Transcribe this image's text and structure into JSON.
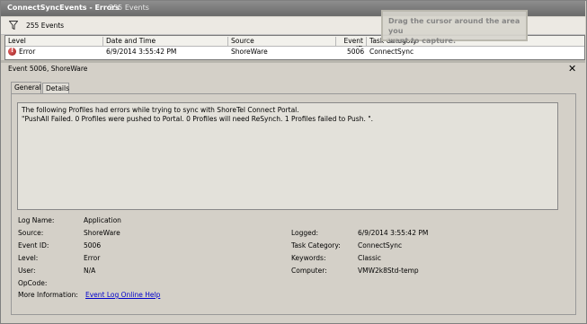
{
  "window": {
    "title": "ConnectSyncEvents - Errors",
    "event_count": "255 Events"
  },
  "filter": {
    "count": "255 Events",
    "icon": "filter-icon"
  },
  "grid": {
    "columns": [
      "Level",
      "Date and Time",
      "Source",
      "Event ID",
      "Task Category"
    ],
    "row": {
      "level": "Error",
      "datetime": "6/9/2014 3:55:42 PM",
      "source": "ShoreWare",
      "event_id": "5006",
      "task_category": "ConnectSync"
    }
  },
  "overlay": {
    "line1": "Drag the cursor around the area you",
    "line2": "want to capture."
  },
  "event": {
    "title": "Event 5006, ShoreWare"
  },
  "tabs": {
    "general": "General",
    "details": "Details"
  },
  "message": {
    "line1": "The following Profiles had errors while trying to sync with ShoreTel Connect Portal.",
    "line2": "\"PushAll Failed. 0 Profiles were pushed to Portal. 0 Profiles will need ReSynch. 1 Profiles failed to Push. \"."
  },
  "props": {
    "log_name_label": "Log Name:",
    "log_name": "Application",
    "source_label": "Source:",
    "source": "ShoreWare",
    "event_id_label": "Event ID:",
    "event_id": "5006",
    "level_label": "Level:",
    "level": "Error",
    "user_label": "User:",
    "user": "N/A",
    "opcode_label": "OpCode:",
    "more_info_label": "More Information:",
    "more_info_link": "Event Log Online Help",
    "logged_label": "Logged:",
    "logged": "6/9/2014 3:55:42 PM",
    "task_category_label": "Task Category:",
    "task_category": "ConnectSync",
    "keywords_label": "Keywords:",
    "keywords": "Classic",
    "computer_label": "Computer:",
    "computer": "VMW2k8Std-temp"
  },
  "colors": {
    "titlebar": "#7a7a7a",
    "background": "#d4d0c8",
    "link": "#0000cc",
    "error_icon": "#b02020"
  }
}
